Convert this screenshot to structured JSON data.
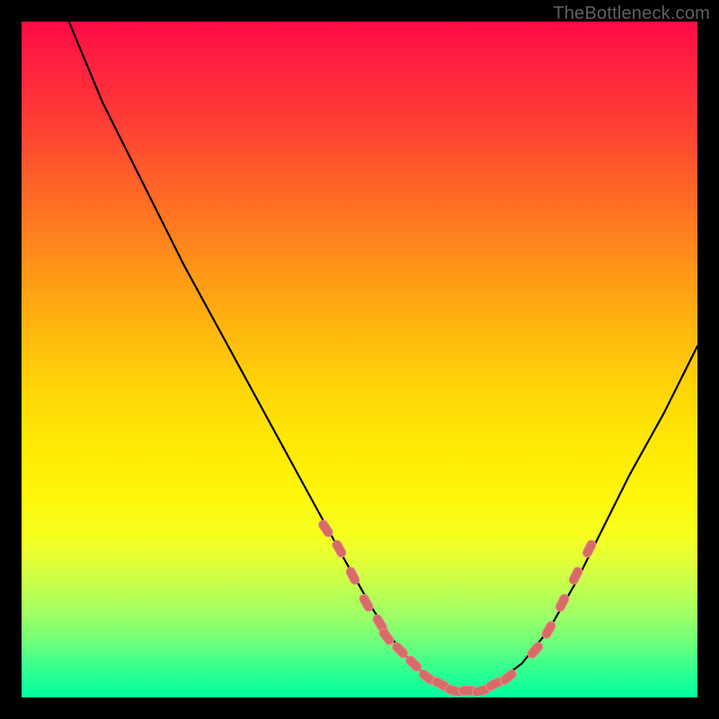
{
  "watermark": {
    "text": "TheBottleneck.com"
  },
  "colors": {
    "frame": "#000000",
    "curve": "#000000",
    "marker": "#d86a68",
    "marker_stroke": "#e38d8a"
  },
  "chart_data": {
    "type": "line",
    "title": "",
    "xlabel": "",
    "ylabel": "",
    "xlim": [
      0,
      100
    ],
    "ylim": [
      0,
      100
    ],
    "grid": false,
    "legend": null,
    "series": [
      {
        "name": "curve",
        "x": [
          7,
          12,
          18,
          24,
          30,
          36,
          42,
          48,
          52,
          56,
          59,
          62,
          64,
          66,
          68,
          70,
          74,
          78,
          82,
          86,
          90,
          95,
          100
        ],
        "y": [
          100,
          88,
          76,
          64,
          53,
          42,
          31,
          20,
          13,
          7,
          4,
          2,
          1,
          1,
          1,
          2,
          5,
          10,
          17,
          25,
          33,
          42,
          52
        ]
      }
    ],
    "markers": {
      "name": "highlighted-points",
      "x": [
        45,
        47,
        49,
        51,
        53,
        54,
        56,
        58,
        60,
        62,
        64,
        66,
        68,
        70,
        72,
        76,
        78,
        80,
        82,
        84
      ],
      "y": [
        25,
        22,
        18,
        14,
        11,
        9,
        7,
        5,
        3,
        2,
        1,
        1,
        1,
        2,
        3,
        7,
        10,
        14,
        18,
        22
      ]
    }
  }
}
